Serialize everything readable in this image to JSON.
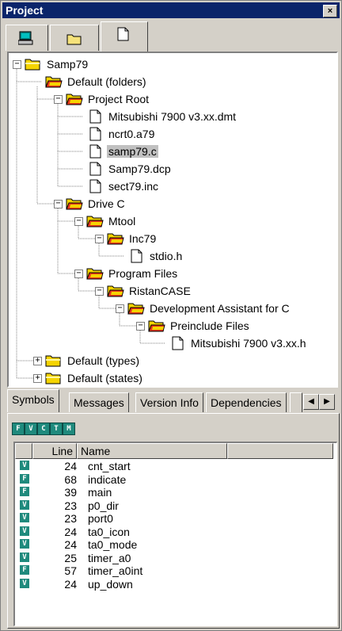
{
  "window": {
    "title": "Project",
    "close_glyph": "×"
  },
  "top_tabs": [
    {
      "icon": "computer-icon"
    },
    {
      "icon": "folder-icon"
    },
    {
      "icon": "document-icon",
      "active": true
    }
  ],
  "tree": [
    {
      "id": "samp79",
      "label": "Samp79",
      "icon": "folder",
      "level": 0,
      "expander": "−"
    },
    {
      "id": "default-folders",
      "label": "Default (folders)",
      "icon": "folder-open",
      "level": 1
    },
    {
      "id": "project-root",
      "label": "Project Root",
      "icon": "folder-open",
      "level": 2,
      "expander": "−"
    },
    {
      "id": "mitsubishi-dmt",
      "label": "Mitsubishi 7900 v3.xx.dmt",
      "icon": "file",
      "level": 3
    },
    {
      "id": "ncrt0",
      "label": "ncrt0.a79",
      "icon": "file",
      "level": 3
    },
    {
      "id": "samp79c",
      "label": "samp79.c",
      "icon": "file",
      "level": 3,
      "selected": true
    },
    {
      "id": "samp79dcp",
      "label": "Samp79.dcp",
      "icon": "file",
      "level": 3
    },
    {
      "id": "sect79",
      "label": "sect79.inc",
      "icon": "file",
      "level": 3
    },
    {
      "id": "drive-c",
      "label": "Drive C",
      "icon": "folder-open",
      "level": 2,
      "expander": "−"
    },
    {
      "id": "mtool",
      "label": "Mtool",
      "icon": "folder-open",
      "level": 3,
      "expander": "−"
    },
    {
      "id": "inc79",
      "label": "Inc79",
      "icon": "folder-open",
      "level": 4,
      "expander": "−"
    },
    {
      "id": "stdio",
      "label": "stdio.h",
      "icon": "file",
      "level": 5
    },
    {
      "id": "program-files",
      "label": "Program Files",
      "icon": "folder-open",
      "level": 3,
      "expander": "−"
    },
    {
      "id": "ristancase",
      "label": "RistanCASE",
      "icon": "folder-open",
      "level": 4,
      "expander": "−"
    },
    {
      "id": "dev-assistant",
      "label": "Development Assistant for C",
      "icon": "folder-open",
      "level": 5,
      "expander": "−"
    },
    {
      "id": "preinclude",
      "label": "Preinclude Files",
      "icon": "folder-open",
      "level": 6,
      "expander": "−"
    },
    {
      "id": "mitsubishi-h",
      "label": "Mitsubishi 7900 v3.xx.h",
      "icon": "file",
      "level": 7
    },
    {
      "id": "default-types",
      "label": "Default (types)",
      "icon": "folder",
      "level": 1,
      "expander": "+"
    },
    {
      "id": "default-states",
      "label": "Default (states)",
      "icon": "folder",
      "level": 1,
      "expander": "+"
    }
  ],
  "bottom_tabs": [
    "Symbols",
    "Messages",
    "Version Info",
    "Dependencies"
  ],
  "filter_buttons": [
    "F",
    "V",
    "C",
    "T",
    "M"
  ],
  "list": {
    "headers": {
      "line": "Line",
      "name": "Name"
    },
    "rows": [
      {
        "kind": "V",
        "line": "24",
        "name": "cnt_start"
      },
      {
        "kind": "F",
        "line": "68",
        "name": "indicate"
      },
      {
        "kind": "F",
        "line": "39",
        "name": "main"
      },
      {
        "kind": "V",
        "line": "23",
        "name": "p0_dir"
      },
      {
        "kind": "V",
        "line": "23",
        "name": "port0"
      },
      {
        "kind": "V",
        "line": "24",
        "name": "ta0_icon"
      },
      {
        "kind": "V",
        "line": "24",
        "name": "ta0_mode"
      },
      {
        "kind": "V",
        "line": "25",
        "name": "timer_a0"
      },
      {
        "kind": "F",
        "line": "57",
        "name": "timer_a0int"
      },
      {
        "kind": "V",
        "line": "24",
        "name": "up_down"
      }
    ]
  },
  "colors": {
    "title_bar": "#0a246a",
    "symbol_badge": "#1f8a7d",
    "folder": "#f5d400",
    "folder_accent": "#e8371a",
    "selection": "#c0c0c0"
  }
}
